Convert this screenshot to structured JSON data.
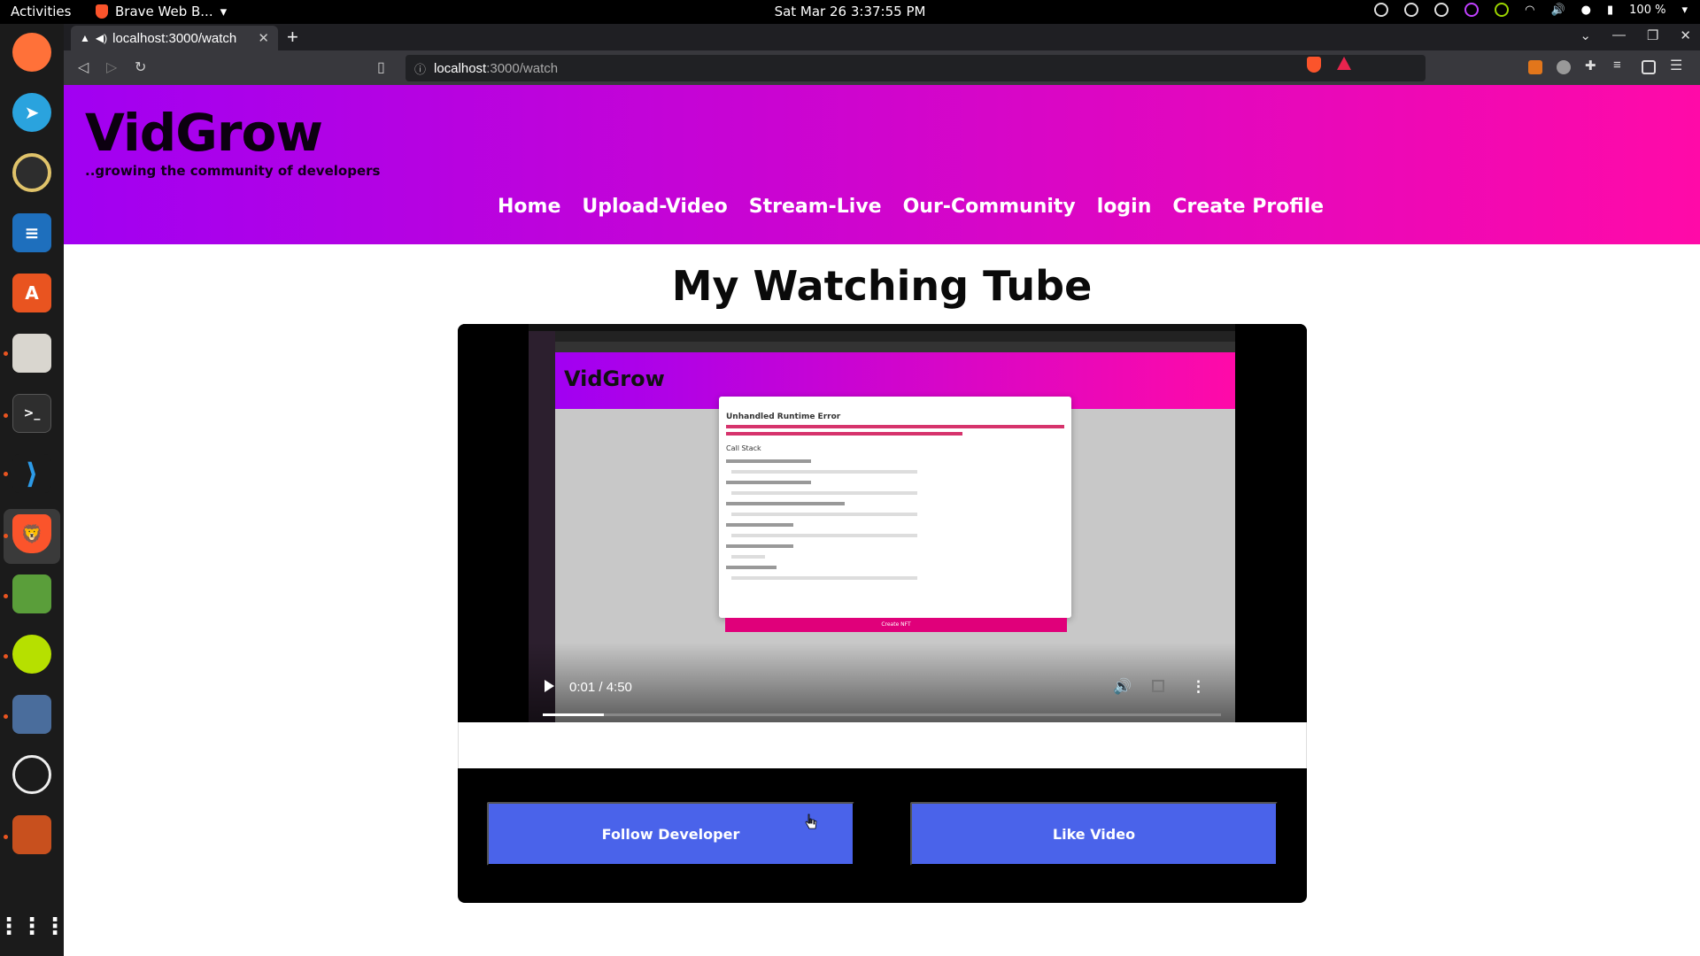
{
  "topbar": {
    "activities": "Activities",
    "app_menu": "Brave Web B...",
    "clock": "Sat Mar 26  3:37:55 PM",
    "battery": "100 %"
  },
  "browser": {
    "tab_title": "localhost:3000/watch",
    "url_host": "localhost",
    "url_path": ":3000/watch"
  },
  "site": {
    "logo": "VidGrow",
    "tagline": "..growing the community of developers",
    "nav": [
      "Home",
      "Upload-Video",
      "Stream-Live",
      "Our-Community",
      "login",
      "Create Profile"
    ]
  },
  "main": {
    "title": "My Watching Tube",
    "video": {
      "time": "0:01 / 4:50",
      "progress_fraction": 0.09,
      "inner_logo": "VidGrow",
      "inner_dialog_title": "Unhandled Runtime Error",
      "inner_dialog_section": "Call Stack",
      "inner_button": "Create NFT"
    },
    "follow_label": "Follow Developer",
    "like_label": "Like Video"
  },
  "colors": {
    "header_start": "#a100f2",
    "header_end": "#ff0aa8",
    "button": "#4a63ea"
  },
  "icons": {
    "dock": [
      "firefox-icon",
      "telegram-icon",
      "rhythmbox-icon",
      "writer-icon",
      "software-icon",
      "files-icon",
      "terminal-icon",
      "vscode-icon",
      "brave-icon",
      "image-viewer-icon",
      "green-app-icon",
      "screenshot-icon",
      "obs-icon",
      "impress-icon",
      "app-grid-icon"
    ]
  }
}
